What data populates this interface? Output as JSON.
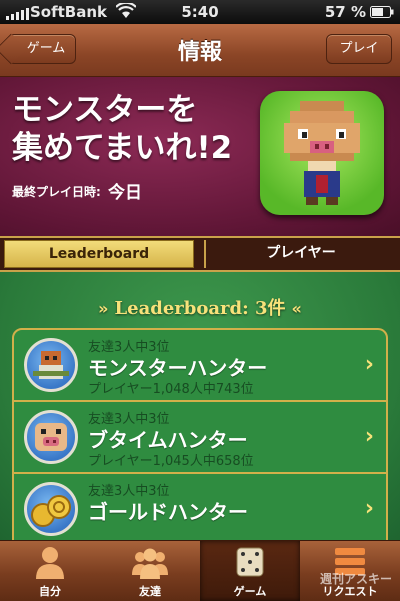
{
  "status_bar": {
    "carrier": "SoftBank",
    "time": "5:40",
    "battery": "57 %"
  },
  "nav": {
    "back_label": "ゲーム",
    "title": "情報",
    "play_label": "プレイ"
  },
  "game": {
    "title_line1": "モンスターを",
    "title_line2": "集めてまいれ!2",
    "last_played_label": "最終プレイ日時:",
    "last_played_value": "今日",
    "icon": "pig-monster-game-icon"
  },
  "segments": {
    "leaderboard": "Leaderboard",
    "player": "プレイヤー"
  },
  "leaderboard": {
    "header": "Leaderboard: 3件",
    "rows": [
      {
        "friends_rank": "友達3人中3位",
        "name": "モンスターハンター",
        "player_rank": "プレイヤー1,048人中743位",
        "icon": "warrior-icon"
      },
      {
        "friends_rank": "友達3人中3位",
        "name": "ブタイムハンター",
        "player_rank": "プレイヤー1,045人中658位",
        "icon": "pig-icon"
      },
      {
        "friends_rank": "友達3人中3位",
        "name": "ゴールドハンター",
        "player_rank": "",
        "icon": "gold-coins-icon"
      }
    ]
  },
  "tabs": [
    {
      "label": "自分",
      "icon": "person-icon"
    },
    {
      "label": "友達",
      "icon": "friends-icon"
    },
    {
      "label": "ゲーム",
      "icon": "dice-icon"
    },
    {
      "label": "リクエスト",
      "icon": "requests-icon"
    }
  ],
  "selected_tab": "ゲーム",
  "watermark": "週刊アスキー",
  "colors": {
    "wood": "#8b4526",
    "banner": "#6e1b42",
    "felt": "#2f8c40",
    "gold": "#d2b04a",
    "accent_text": "#f7e27a"
  }
}
